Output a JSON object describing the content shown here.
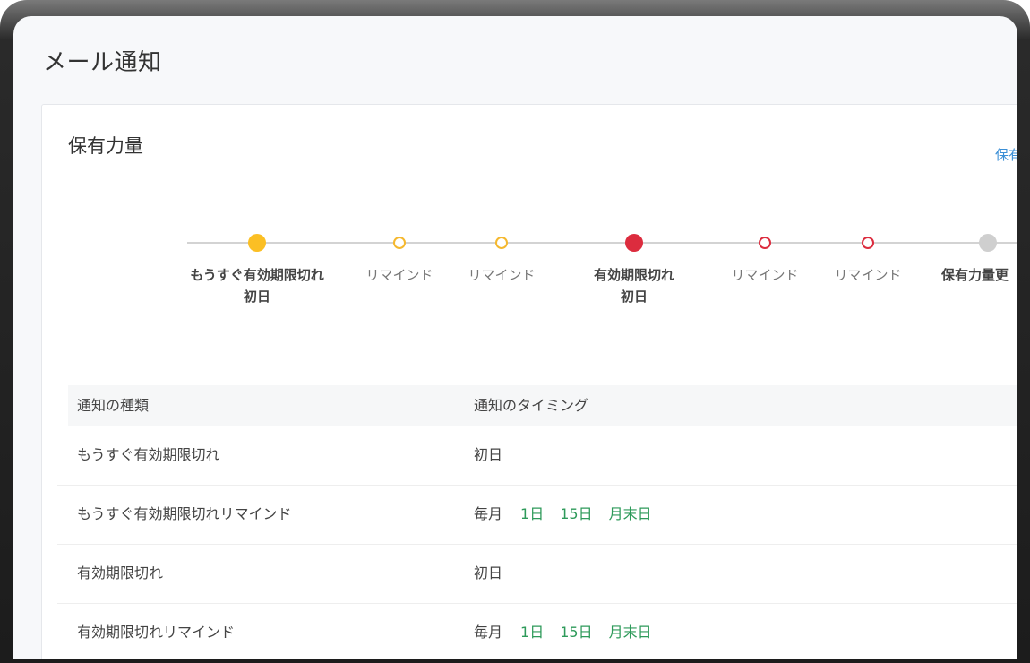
{
  "page": {
    "title": "メール通知"
  },
  "card": {
    "title": "保有力量",
    "link_label": "保有"
  },
  "timeline": {
    "nodes": [
      {
        "line1": "もうすぐ有効期限切れ",
        "line2": "初日",
        "style": "yellow-fill",
        "bold": true
      },
      {
        "line1": "リマインド",
        "line2": "",
        "style": "yellow-ring",
        "bold": false
      },
      {
        "line1": "リマインド",
        "line2": "",
        "style": "yellow-ring",
        "bold": false
      },
      {
        "line1": "有効期限切れ",
        "line2": "初日",
        "style": "red-fill",
        "bold": true
      },
      {
        "line1": "リマインド",
        "line2": "",
        "style": "red-ring",
        "bold": false
      },
      {
        "line1": "リマインド",
        "line2": "",
        "style": "red-ring",
        "bold": false
      },
      {
        "line1": "保有力量更",
        "line2": "",
        "style": "gray-fill",
        "bold": true
      }
    ]
  },
  "table": {
    "headers": {
      "type": "通知の種類",
      "timing": "通知のタイミング"
    },
    "rows": [
      {
        "type": "もうすぐ有効期限切れ",
        "timing_prefix": "初日",
        "tags": []
      },
      {
        "type": "もうすぐ有効期限切れリマインド",
        "timing_prefix": "毎月",
        "tags": [
          "1日",
          "15日",
          "月末日"
        ]
      },
      {
        "type": "有効期限切れ",
        "timing_prefix": "初日",
        "tags": []
      },
      {
        "type": "有効期限切れリマインド",
        "timing_prefix": "毎月",
        "tags": [
          "1日",
          "15日",
          "月末日"
        ]
      }
    ]
  },
  "colors": {
    "accent_yellow": "#fbbf24",
    "accent_red": "#dc2c3e",
    "tag_green": "#2e9a5a",
    "link_blue": "#3b8fd6"
  }
}
